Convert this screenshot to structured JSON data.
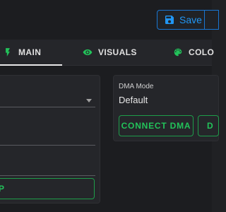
{
  "toolbar": {
    "save_label": "Save"
  },
  "tabs": [
    {
      "label": "MAIN",
      "icon": "lightning-icon",
      "active": true
    },
    {
      "label": "VISUALS",
      "icon": "eye-icon",
      "active": false
    },
    {
      "label": "COLO",
      "icon": "palette-icon",
      "active": false
    }
  ],
  "left_card": {
    "button_label": "P"
  },
  "dma": {
    "label": "DMA Mode",
    "value": "Default",
    "connect_label": "CONNECT DMA",
    "second_button_label": "D"
  },
  "colors": {
    "accent_blue": "#2196f3",
    "accent_green": "#22c35a",
    "background": "#202124"
  }
}
